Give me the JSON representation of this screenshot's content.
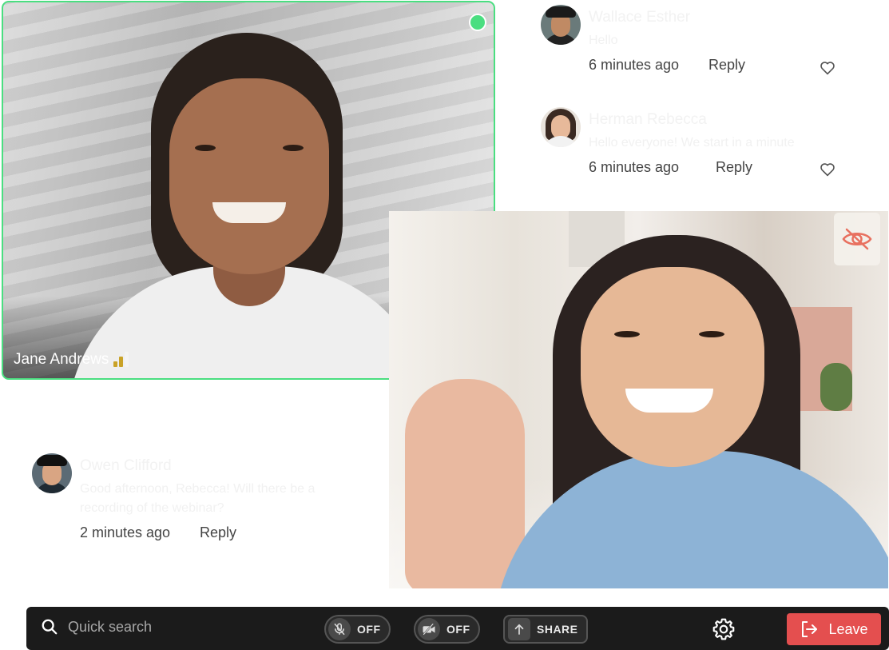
{
  "tiles": {
    "jane": {
      "name": "Jane Andrews",
      "status": "online"
    },
    "rebecca": {
      "hide_video_icon": "eye-off-icon"
    }
  },
  "comments": [
    {
      "author": "Wallace Esther",
      "text": "Hello",
      "time": "6 minutes ago",
      "reply_label": "Reply",
      "liked": false
    },
    {
      "author": "Herman Rebecca",
      "text": "Hello everyone! We start in a minute",
      "time": "6 minutes ago",
      "reply_label": "Reply",
      "liked": false
    },
    {
      "author": "Owen Clifford",
      "text": "Good afternoon, Rebecca! Will there be a recording of the webinar?",
      "time": "2 minutes ago",
      "reply_label": "Reply"
    }
  ],
  "toolbar": {
    "search_placeholder": "Quick search",
    "mic_label": "OFF",
    "camera_label": "OFF",
    "share_label": "SHARE",
    "leave_label": "Leave"
  },
  "colors": {
    "online": "#4ade80",
    "leave": "#e44f4f",
    "hide_icon": "#e8705f",
    "signal_active": "#c9a227"
  }
}
